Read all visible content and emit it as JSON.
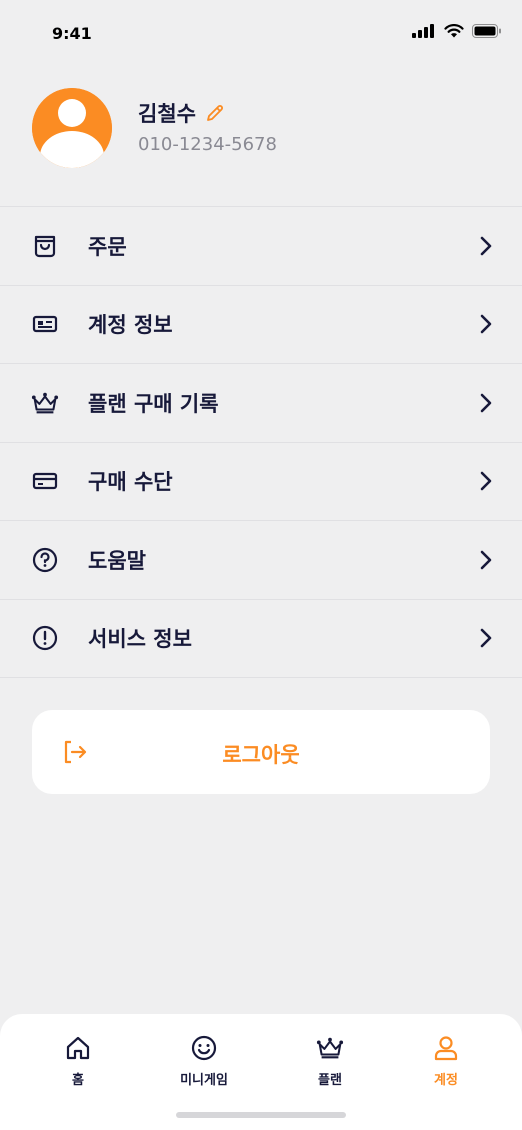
{
  "status_bar": {
    "time": "9:41"
  },
  "profile": {
    "name": "김철수",
    "phone": "010-1234-5678"
  },
  "menu": {
    "items": [
      {
        "label": "주문",
        "icon": "shopping-bag-icon"
      },
      {
        "label": "계정 정보",
        "icon": "id-card-icon"
      },
      {
        "label": "플랜 구매 기록",
        "icon": "crown-icon"
      },
      {
        "label": "구매 수단",
        "icon": "credit-card-icon"
      },
      {
        "label": "도움말",
        "icon": "help-circle-icon"
      },
      {
        "label": "서비스 정보",
        "icon": "info-circle-icon"
      }
    ]
  },
  "logout": {
    "label": "로그아웃",
    "icon": "logout-icon"
  },
  "tab_bar": {
    "tabs": [
      {
        "label": "홈",
        "icon": "home-icon"
      },
      {
        "label": "미니게임",
        "icon": "smile-icon"
      },
      {
        "label": "플랜",
        "icon": "crown-icon"
      },
      {
        "label": "계정",
        "icon": "user-icon",
        "active": true
      }
    ]
  },
  "colors": {
    "accent": "#fb8c23",
    "text": "#17193a",
    "muted": "#8a8a93",
    "background": "#efeff0"
  }
}
